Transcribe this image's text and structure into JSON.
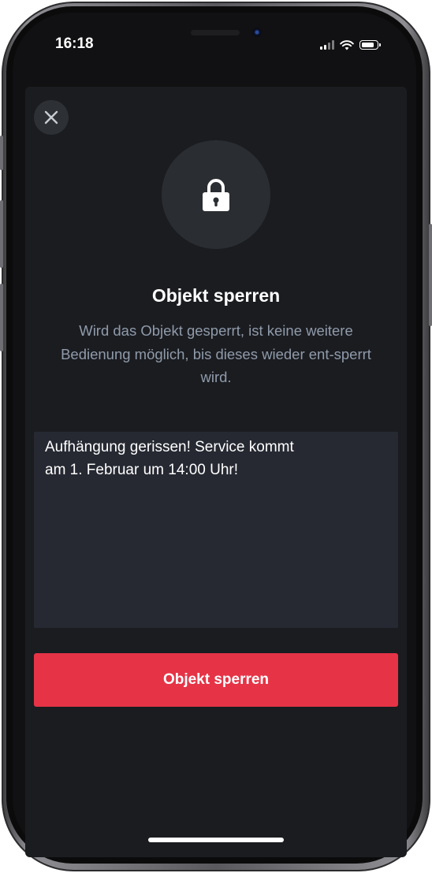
{
  "status_bar": {
    "time": "16:18",
    "icons": [
      "cellular-signal-icon",
      "wifi-icon",
      "battery-icon"
    ]
  },
  "modal": {
    "close_icon": "close-icon",
    "lock_icon": "lock-icon",
    "title": "Objekt sperren",
    "description": "Wird das Objekt gesperrt, ist keine weitere Bedienung möglich, bis dieses wieder ent-sperrt wird.",
    "note_value": "Aufhängung gerissen! Service kommt\nam 1. Februar um 14:00 Uhr!",
    "primary_button_label": "Objekt sperren"
  },
  "colors": {
    "background": "#111113",
    "sheet": "#1b1c20",
    "field": "#262932",
    "accent": "#e63346",
    "secondary_text": "#8f9bab"
  }
}
